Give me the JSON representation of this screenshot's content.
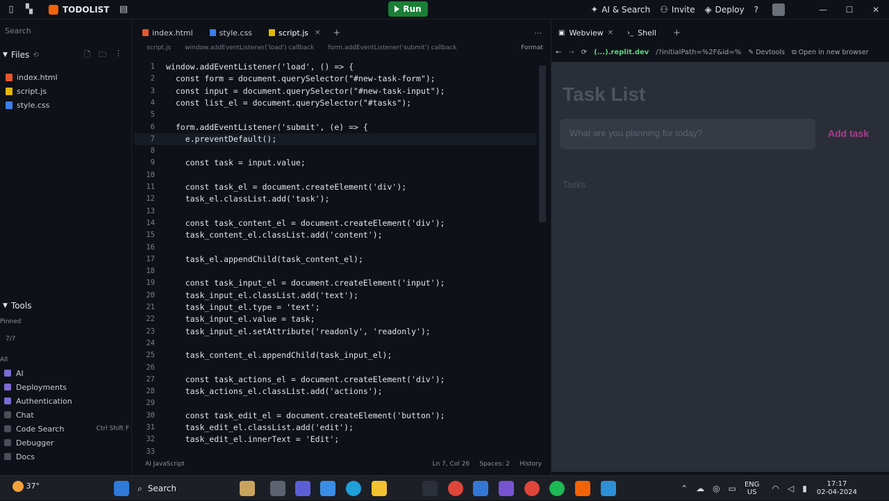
{
  "topbar": {
    "repl_name": "TODOLIST",
    "run_label": "Run",
    "ai_search": "AI & Search",
    "invite": "Invite",
    "deploy": "Deploy",
    "help": "?",
    "minimize": "—",
    "maximize": "☐",
    "close": "✕"
  },
  "sidebar": {
    "search_label": "Search",
    "files_label": "Files",
    "files": [
      {
        "name": "index.html",
        "color": "#e4572e"
      },
      {
        "name": "script.js",
        "color": "#e2b800"
      },
      {
        "name": "style.css",
        "color": "#3d7ee8"
      }
    ],
    "tools_label": "Tools",
    "small_label_1": "Pinned",
    "small_label_2": "7/7",
    "small_label_3": "All",
    "tools": [
      {
        "name": "AI",
        "shortcut": ""
      },
      {
        "name": "Deployments",
        "shortcut": ""
      },
      {
        "name": "Authentication",
        "shortcut": ""
      },
      {
        "name": "Chat",
        "shortcut": ""
      },
      {
        "name": "Code Search",
        "shortcut": "Ctrl Shift F"
      },
      {
        "name": "Debugger",
        "shortcut": ""
      },
      {
        "name": "Docs",
        "shortcut": ""
      }
    ]
  },
  "editor": {
    "tabs": [
      {
        "name": "index.html",
        "color": "#e4572e",
        "active": false
      },
      {
        "name": "style.css",
        "color": "#3d7ee8",
        "active": false
      },
      {
        "name": "script.js",
        "color": "#e2b800",
        "active": true
      }
    ],
    "breadcrumb": [
      "script.js",
      "window.addEventListener('load') callback",
      "form.addEventListener('submit') callback",
      "Format"
    ],
    "lines": [
      {
        "n": "1",
        "text": "window.addEventListener('load', () => {"
      },
      {
        "n": "2",
        "text": "  const form = document.querySelector(\"#new-task-form\");"
      },
      {
        "n": "3",
        "text": "  const input = document.querySelector(\"#new-task-input\");"
      },
      {
        "n": "4",
        "text": "  const list_el = document.querySelector(\"#tasks\");"
      },
      {
        "n": "5",
        "text": ""
      },
      {
        "n": "6",
        "text": "  form.addEventListener('submit', (e) => {"
      },
      {
        "n": "7",
        "text": "    e.preventDefault();"
      },
      {
        "n": "8",
        "text": ""
      },
      {
        "n": "9",
        "text": "    const task = input.value;"
      },
      {
        "n": "10",
        "text": ""
      },
      {
        "n": "11",
        "text": "    const task_el = document.createElement('div');"
      },
      {
        "n": "12",
        "text": "    task_el.classList.add('task');"
      },
      {
        "n": "13",
        "text": ""
      },
      {
        "n": "14",
        "text": "    const task_content_el = document.createElement('div');"
      },
      {
        "n": "15",
        "text": "    task_content_el.classList.add('content');"
      },
      {
        "n": "16",
        "text": ""
      },
      {
        "n": "17",
        "text": "    task_el.appendChild(task_content_el);"
      },
      {
        "n": "18",
        "text": ""
      },
      {
        "n": "19",
        "text": "    const task_input_el = document.createElement('input');"
      },
      {
        "n": "20",
        "text": "    task_input_el.classList.add('text');"
      },
      {
        "n": "21",
        "text": "    task_input_el.type = 'text';"
      },
      {
        "n": "22",
        "text": "    task_input_el.value = task;"
      },
      {
        "n": "23",
        "text": "    task_input_el.setAttribute('readonly', 'readonly');"
      },
      {
        "n": "24",
        "text": ""
      },
      {
        "n": "25",
        "text": "    task_content_el.appendChild(task_input_el);"
      },
      {
        "n": "26",
        "text": ""
      },
      {
        "n": "27",
        "text": "    const task_actions_el = document.createElement('div');"
      },
      {
        "n": "28",
        "text": "    task_actions_el.classList.add('actions');"
      },
      {
        "n": "29",
        "text": ""
      },
      {
        "n": "30",
        "text": "    const task_edit_el = document.createElement('button');"
      },
      {
        "n": "31",
        "text": "    task_edit_el.classList.add('edit');"
      },
      {
        "n": "32",
        "text": "    task_edit_el.innerText = 'Edit';"
      },
      {
        "n": "33",
        "text": ""
      }
    ],
    "status_left": "AI  JavaScript",
    "status_pos": "Ln 7, Col 26",
    "status_spaces": "Spaces: 2",
    "status_history": "History"
  },
  "webpane": {
    "tab_webview": "Webview",
    "tab_shell": "Shell",
    "url_host": "(...).replit.dev",
    "url_path": "/?initialPath=%2F&id=%",
    "devtools": "Devtools",
    "open_new_tab": "Open in new browser",
    "page": {
      "title": "Task List",
      "input_placeholder": "What are you planning for today?",
      "add_button": "Add task",
      "tasks_heading": "Tasks"
    }
  },
  "taskbar": {
    "weather": "37°",
    "search": "Search",
    "lang_1": "ENG",
    "lang_2": "US",
    "time": "17:17",
    "date": "02-04-2024"
  }
}
